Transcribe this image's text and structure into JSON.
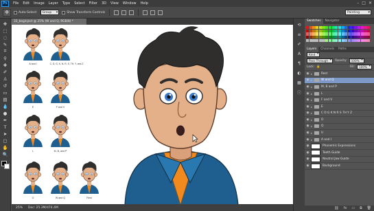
{
  "app": {
    "logo": "Ps"
  },
  "menu": {
    "items": [
      "File",
      "Edit",
      "Image",
      "Layer",
      "Type",
      "Select",
      "Filter",
      "3D",
      "View",
      "Window",
      "Help"
    ]
  },
  "window_controls": [
    "–",
    "□",
    "✕"
  ],
  "options": {
    "auto_select_label": "Auto-Select:",
    "auto_select_value": "Group",
    "transform_label": "Show Transform Controls",
    "workspace": "Painting"
  },
  "document": {
    "tab_title": "33_beginject @ 25% (W and Q, RGB/8) *",
    "zoom": "25%",
    "doc_info": "Doc: 25.3M/474.4M"
  },
  "thumbnails": [
    {
      "label": "A and I"
    },
    {
      "label": "C, D, G, K, N, R, S, TH, Y, and Z"
    },
    {
      "label": "E"
    },
    {
      "label": "F and V"
    },
    {
      "label": "L"
    },
    {
      "label": "M, B, and P"
    },
    {
      "label": "O"
    },
    {
      "label": "Q"
    },
    {
      "label": "U"
    },
    {
      "label": "W and Q"
    },
    {
      "label": "Rest"
    }
  ],
  "panels": {
    "top_tabs": [
      "Swatches",
      "Navigator"
    ],
    "layers_tabs": [
      "Layers",
      "Channels",
      "Paths"
    ],
    "kind_label": "Kind",
    "blend_mode": "Pass Through",
    "opacity_label": "Opacity:",
    "opacity_value": "100%",
    "lock_label": "Lock:",
    "fill_label": "Fill:",
    "fill_value": "100%"
  },
  "layers": [
    {
      "name": "Rest",
      "type": "group",
      "selected": false
    },
    {
      "name": "W and Q",
      "type": "group",
      "selected": true
    },
    {
      "name": "M, B and P",
      "type": "group",
      "selected": false
    },
    {
      "name": "L",
      "type": "group",
      "selected": false
    },
    {
      "name": "F and V",
      "type": "group",
      "selected": false
    },
    {
      "name": "E",
      "type": "group",
      "selected": false
    },
    {
      "name": "C D G K N R S TH Y Z",
      "type": "group",
      "selected": false
    },
    {
      "name": "O",
      "type": "group",
      "selected": false
    },
    {
      "name": "Q",
      "type": "group",
      "selected": false
    },
    {
      "name": "U",
      "type": "group",
      "selected": false
    },
    {
      "name": "A and I",
      "type": "group",
      "selected": false
    },
    {
      "name": "Phonemic Expressions",
      "type": "layer",
      "selected": false
    },
    {
      "name": "Teeth Guide",
      "type": "layer",
      "selected": false
    },
    {
      "name": "Neutral Jaw Guide",
      "type": "layer",
      "selected": false
    },
    {
      "name": "Background",
      "type": "layer",
      "selected": false
    }
  ],
  "colors": {
    "hair": "#2f2e2d",
    "skin": "#e4b08a",
    "jacket": "#1f5f8f",
    "shirt": "#f08a1e",
    "layer_selected": "#7d99c6"
  },
  "icons": {
    "tools": [
      "move-icon",
      "marquee-icon",
      "lasso-icon",
      "quick-select-icon",
      "crop-icon",
      "eyedropper-icon",
      "healing-icon",
      "brush-icon",
      "clone-stamp-icon",
      "history-brush-icon",
      "eraser-icon",
      "gradient-icon",
      "blur-icon",
      "dodge-icon",
      "pen-icon",
      "type-icon",
      "path-select-icon",
      "shape-icon",
      "hand-icon",
      "zoom-icon"
    ]
  }
}
